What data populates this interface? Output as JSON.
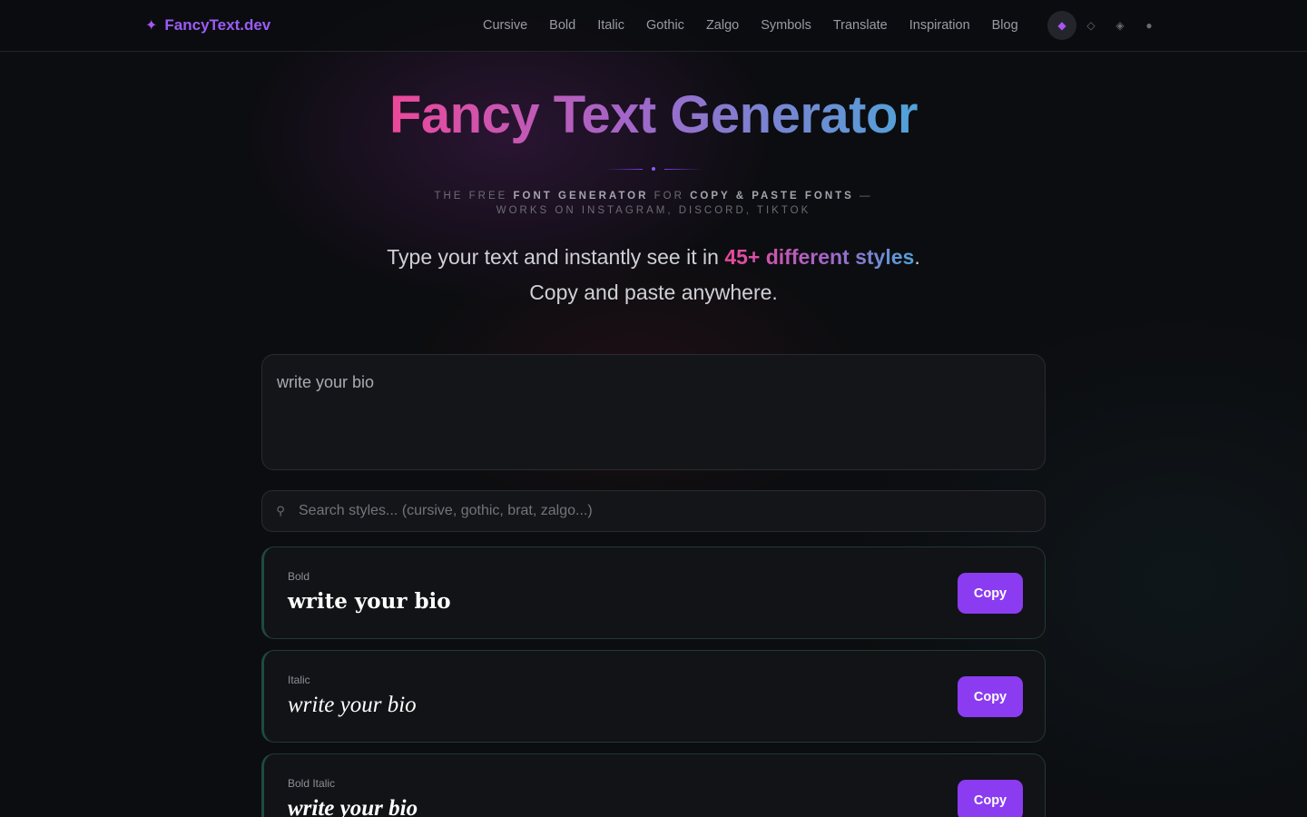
{
  "brand": {
    "name": "FancyText.dev",
    "icon": "sparkle-icon"
  },
  "nav": {
    "links": [
      "Cursive",
      "Bold",
      "Italic",
      "Gothic",
      "Zalgo",
      "Symbols",
      "Translate",
      "Inspiration",
      "Blog"
    ],
    "theme_icons": [
      "◆",
      "◇",
      "◈",
      "●"
    ]
  },
  "hero": {
    "title": "Fancy Text Generator",
    "tagline": {
      "p1": "The free ",
      "b1": "font generator",
      "p2": " for ",
      "b2": "copy & paste fonts",
      "p3": " — works on Instagram, Discord, TikTok"
    },
    "lead": {
      "before": "Type your text and instantly see it in ",
      "highlight": "45+ different styles",
      "after": ". Copy and paste anywhere."
    }
  },
  "editor": {
    "value": "write your bio"
  },
  "search": {
    "placeholder": "Search styles... (cursive, gothic, brat, zalgo...)",
    "icon": "search-icon"
  },
  "styles": [
    {
      "label": "Bold",
      "preview": "write your bio",
      "copy": "Copy"
    },
    {
      "label": "Italic",
      "preview": "write your bio",
      "copy": "Copy"
    },
    {
      "label": "Bold Italic",
      "preview": "write your bio",
      "copy": "Copy"
    }
  ],
  "colors": {
    "accent": "#8b3cf0",
    "gradient_start": "#ec4899",
    "gradient_end": "#4fa3d9"
  }
}
